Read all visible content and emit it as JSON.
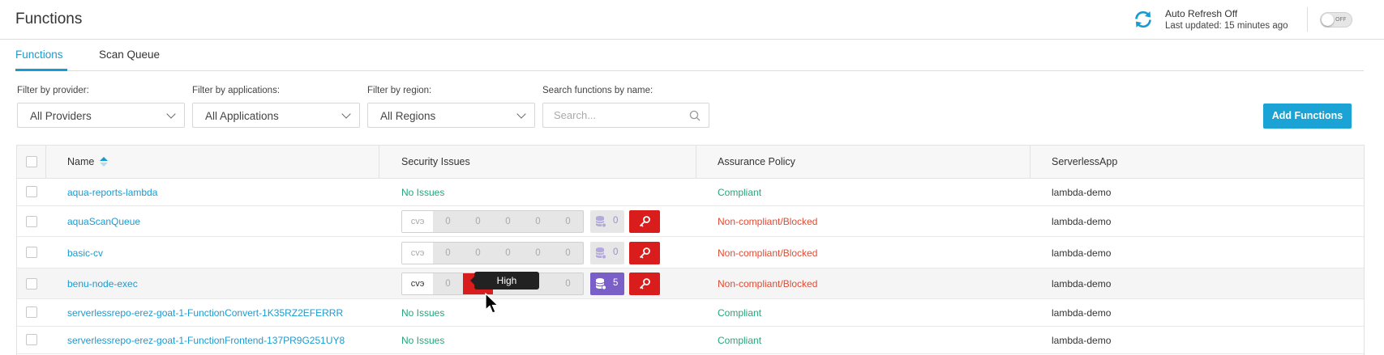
{
  "header": {
    "title": "Functions",
    "auto_refresh": "Auto Refresh Off",
    "last_updated": "Last updated: 15 minutes ago",
    "toggle_label": "OFF",
    "refresh_icon": "refresh-icon"
  },
  "tabs": [
    {
      "label": "Functions",
      "active": true
    },
    {
      "label": "Scan Queue",
      "active": false
    }
  ],
  "filters": {
    "provider_label": "Filter by provider:",
    "provider_value": "All Providers",
    "applications_label": "Filter by applications:",
    "applications_value": "All Applications",
    "region_label": "Filter by region:",
    "region_value": "All Regions",
    "search_label": "Search functions by name:",
    "search_placeholder": "Search...",
    "search_value": ""
  },
  "add_button": "Add Functions",
  "colors": {
    "accent": "#1a9bd0",
    "compliant": "#26a57a",
    "noncompliant": "#e04b33",
    "high": "#d91d1d",
    "malware": "#7a5fc8"
  },
  "table": {
    "columns": [
      "Name",
      "Security Issues",
      "Assurance Policy",
      "ServerlessApp"
    ],
    "sort": {
      "column": "Name",
      "direction": "ascending"
    },
    "rows": [
      {
        "name": "aqua-reports-lambda",
        "issues": "No Issues",
        "policy": "Compliant",
        "app": "lambda-demo"
      },
      {
        "name": "aquaScanQueue",
        "cve_label": "cvэ",
        "vulns": [
          "0",
          "0",
          "0",
          "0",
          "0"
        ],
        "malware": "0",
        "policy": "Non-compliant/Blocked",
        "app": "lambda-demo"
      },
      {
        "name": "basic-cv",
        "cve_label": "cvэ",
        "vulns": [
          "0",
          "0",
          "0",
          "0",
          "0"
        ],
        "malware": "0",
        "policy": "Non-compliant/Blocked",
        "app": "lambda-demo"
      },
      {
        "name": "benu-node-exec",
        "cve_label": "cvэ",
        "vulns": [
          "0",
          "1",
          "",
          "",
          "0"
        ],
        "malware": "5",
        "policy": "Non-compliant/Blocked",
        "app": "lambda-demo"
      },
      {
        "name": "serverlessrepo-erez-goat-1-FunctionConvert-1K35RZ2EFERRR",
        "issues": "No Issues",
        "policy": "Compliant",
        "app": "lambda-demo"
      },
      {
        "name": "serverlessrepo-erez-goat-1-FunctionFrontend-137PR9G251UY8",
        "issues": "No Issues",
        "policy": "Compliant",
        "app": "lambda-demo"
      }
    ]
  },
  "tooltip": "High"
}
